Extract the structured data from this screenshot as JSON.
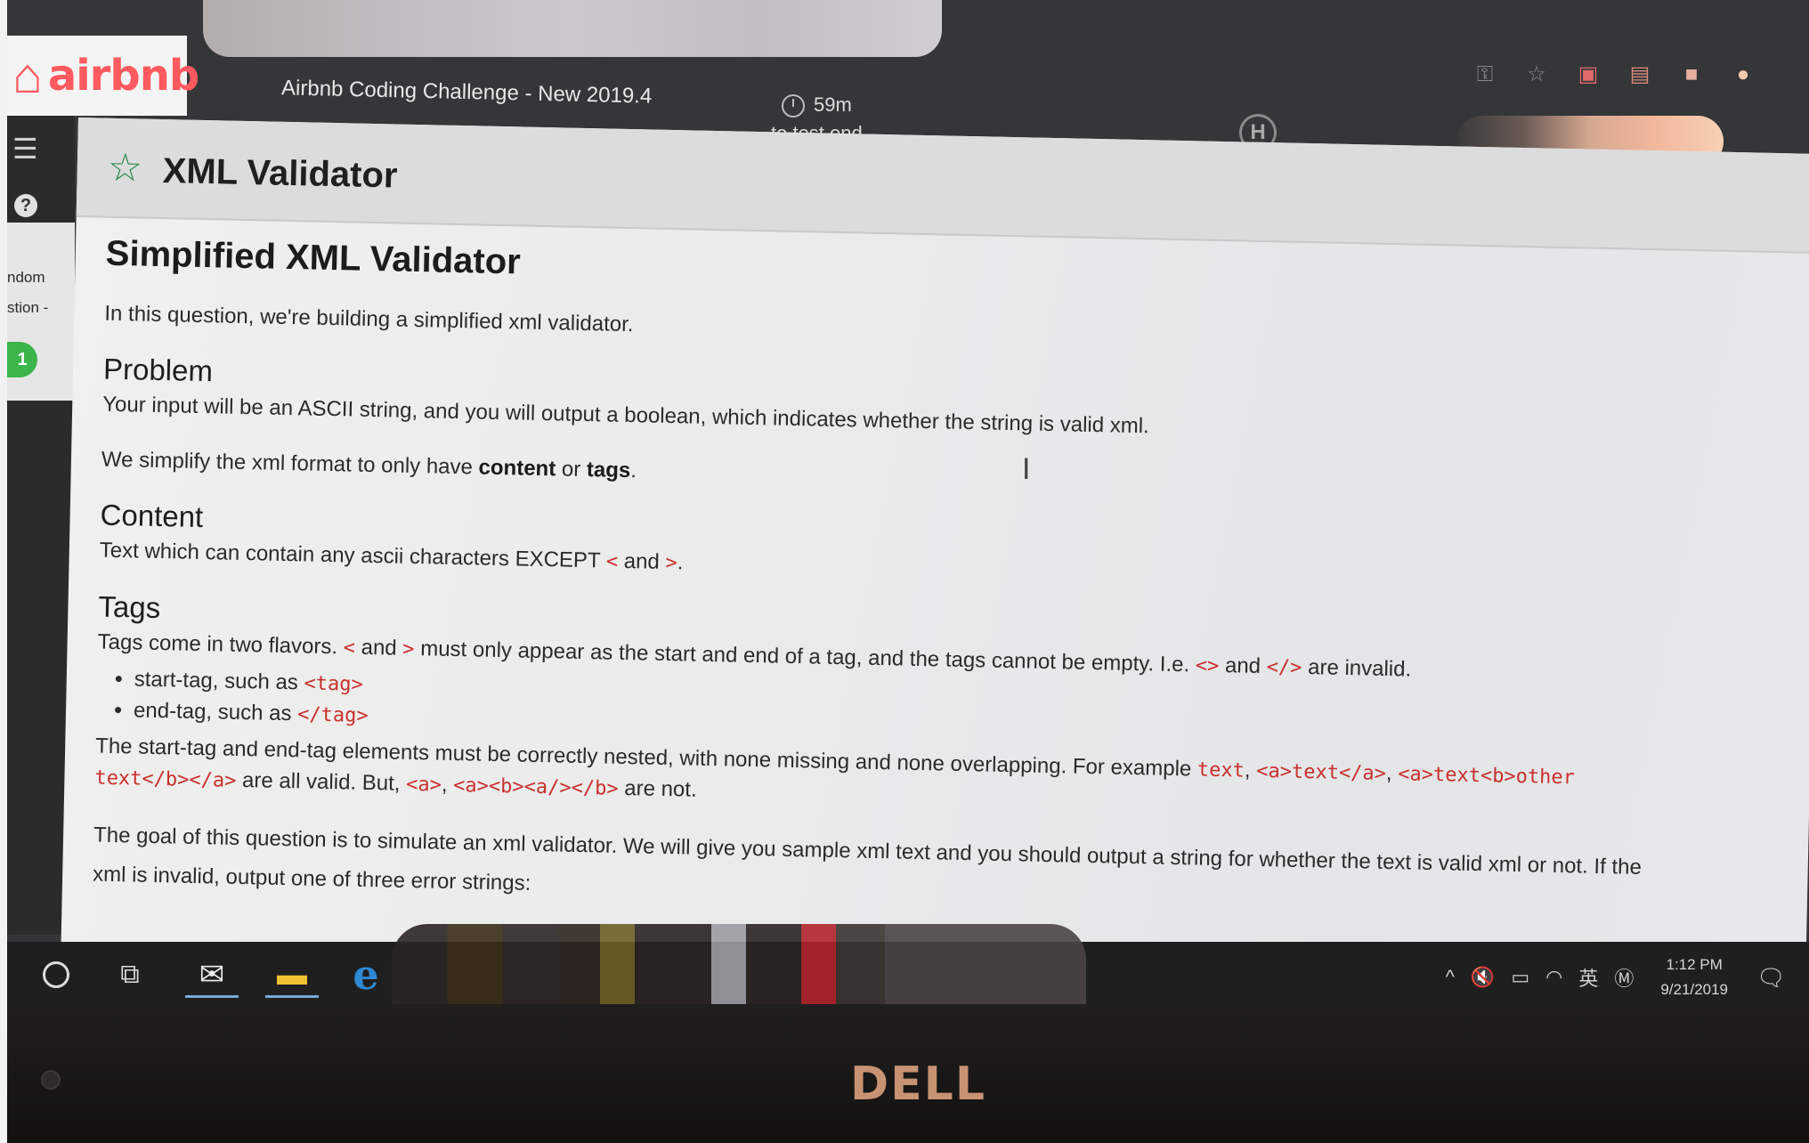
{
  "app": {
    "logo_text": "airbnb",
    "header_title": "Airbnb Coding Challenge - New 2019.4",
    "timer_value": "59m",
    "timer_caption": "to test end",
    "brand_color": "#ff5a5f"
  },
  "rail": {
    "text_line1": "ndom",
    "text_line2": "stion -",
    "badge": "1"
  },
  "panel": {
    "title": "XML Validator"
  },
  "question": {
    "heading": "Simplified XML Validator",
    "intro": "In this question, we're building a simplified xml validator.",
    "problem_heading": "Problem",
    "problem_text": "Your input will be an ASCII string, and you will output a boolean, which indicates whether the string is valid xml.",
    "simplify_prefix": "We simplify the xml format to only have",
    "simplify_content": "content",
    "simplify_or": "or",
    "simplify_tags": "tags",
    "simplify_end": ".",
    "content_heading": "Content",
    "content_prefix": "Text which can contain any ascii characters EXCEPT",
    "content_lt": "<",
    "content_and": "and",
    "content_gt": ">",
    "content_end": ".",
    "tags_heading": "Tags",
    "tags_prefix": "Tags come in two flavors.",
    "tags_lt": "<",
    "tags_and": "and",
    "tags_gt": ">",
    "tags_mid": "must only appear as the start and end of a tag, and the tags cannot be empty. I.e.",
    "tags_empty1": "<>",
    "tags_and2": "and",
    "tags_empty2": "</>",
    "tags_invalid": "are invalid.",
    "bullet1_text": "start-tag, such as",
    "bullet1_code": "<tag>",
    "bullet2_text": "end-tag, such as",
    "bullet2_code": "</tag>",
    "nested_text": "The start-tag and end-tag elements must be correctly nested, with none missing and none overlapping.  For example",
    "ex1": "text",
    "ex2": "<a>text</a>",
    "ex3a": "<a>text<b>other",
    "ex3b": "text</b></a>",
    "valid_text": "are all valid.  But,",
    "bad1": "<a>",
    "bad2": "<a><b><a/></b>",
    "not_text": "are not.",
    "goal_text": "The goal of this question is to simulate an xml validator. We will give you sample xml text and you should output a string for whether the text is valid xml or not.  If the",
    "goal_cut": "xml is invalid, output one of three error strings:"
  },
  "tray": {
    "lang": "英",
    "time": "1:12 PM",
    "date": "9/21/2019"
  },
  "hardware": {
    "brand": "DELL"
  }
}
